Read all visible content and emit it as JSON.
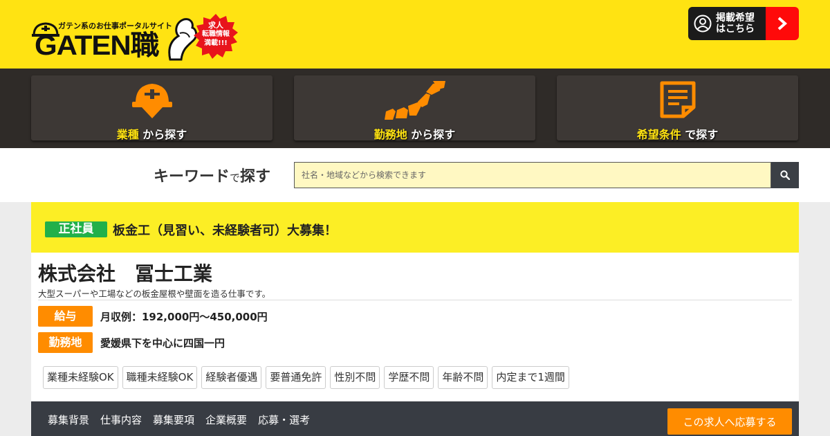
{
  "header": {
    "logo_tagline": "ガテン系のお仕事ポータルサイト",
    "logo_text": "GATEN職",
    "logo_badge": [
      "求人",
      "転職情報",
      "満載!!!"
    ],
    "post_button_line1": "掲載希望",
    "post_button_line2": "はこちら",
    "colors": {
      "background": "#ffe312",
      "post_accent": "#ff0a0a"
    }
  },
  "nav": {
    "tiles": [
      {
        "highlight": "業種",
        "rest": " から探す",
        "icon": "helmet-icon"
      },
      {
        "highlight": "勤務地",
        "rest": " から探す",
        "icon": "japan-map-icon"
      },
      {
        "highlight": "希望条件",
        "rest": " で探す",
        "icon": "checklist-icon"
      }
    ],
    "colors": {
      "band": "#2f2b28",
      "icon": "#ff8c00",
      "highlight": "#ffe312"
    }
  },
  "search": {
    "label_main": "キーワード",
    "label_particle": "で",
    "label_action": "探す",
    "placeholder": "社名・地域などから検索できます",
    "button_icon": "search-icon"
  },
  "job": {
    "employment_type": "正社員",
    "title": "板金工（見習い、未経験者可）大募集！",
    "company": "株式会社　冨士工業",
    "description": "大型スーパーや工場などの板金屋根や壁面を造る仕事です。",
    "salary_label": "給与",
    "salary_value": "月収例：192,000円～450,000円",
    "location_label": "勤務地",
    "location_value": "愛媛県下を中心に四国一円",
    "tags": [
      "業種未経験OK",
      "職種未経験OK",
      "経験者優遇",
      "要普通免許",
      "性別不問",
      "学歴不問",
      "年齢不問",
      "内定まで1週間"
    ],
    "colors": {
      "title_bar": "#fcee25",
      "type_badge": "#22b04a",
      "label": "#ff8c00"
    }
  },
  "tabs": {
    "items": [
      "募集背景",
      "仕事内容",
      "募集要項",
      "企業概要",
      "応募・選考"
    ],
    "apply_label": "この求人へ応募する"
  }
}
